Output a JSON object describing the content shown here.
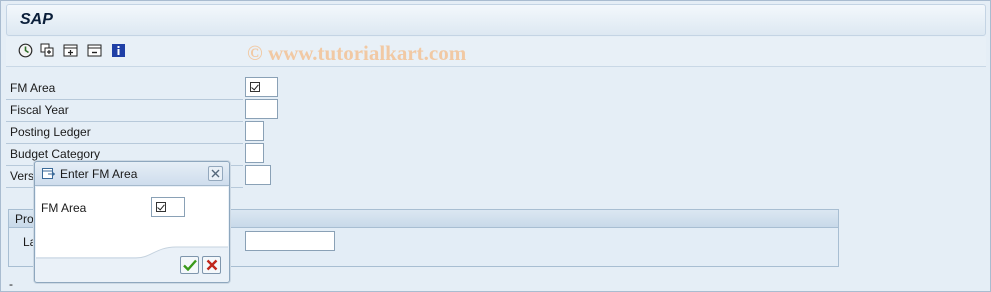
{
  "window": {
    "title": "SAP",
    "watermark": "© www.tutorialkart.com"
  },
  "toolbar": {
    "icons": [
      "execute-icon",
      "get-variant-icon",
      "new-entry-icon",
      "delete-icon",
      "info-icon"
    ],
    "colors": {
      "execute": "#2f6f2a",
      "info": "#1f3fa6"
    }
  },
  "form": {
    "fm_area_label": "FM Area",
    "fiscal_year_label": "Fiscal Year",
    "posting_ledger_label": "Posting Ledger",
    "budget_category_label": "Budget Category",
    "version_label": "Vers"
  },
  "group": {
    "title": "Pro",
    "field_label": "La"
  },
  "dialog": {
    "title": "Enter FM Area",
    "fm_area_label": "FM Area",
    "ok_color": "#3a9a1a",
    "cancel_color": "#c0261b"
  },
  "footer": {
    "dash": "-"
  }
}
